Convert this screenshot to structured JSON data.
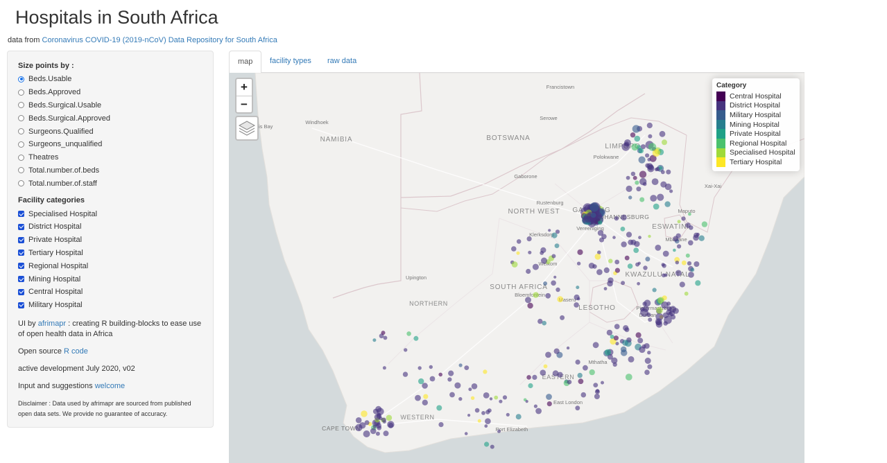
{
  "page": {
    "title": "Hospitals in South Africa",
    "source_prefix": "data from",
    "source_link": "Coronavirus COVID-19 (2019-nCoV) Data Repository for South Africa"
  },
  "sidebar": {
    "size_label": "Size points by :",
    "size_options": [
      "Beds.Usable",
      "Beds.Approved",
      "Beds.Surgical.Usable",
      "Beds.Surgical.Approved",
      "Surgeons.Qualified",
      "Surgeons_unqualified",
      "Theatres",
      "Total.number.of.beds",
      "Total.number.of.staff"
    ],
    "selected_size": "Beds.Usable",
    "categories_label": "Facility categories",
    "categories": [
      "Specialised Hospital",
      "District Hospital",
      "Private Hospital",
      "Tertiary Hospital",
      "Regional Hospital",
      "Mining Hospital",
      "Central Hospital",
      "Military Hospital"
    ],
    "ui_prefix": "UI by",
    "ui_link": "afrimapr",
    "ui_suffix": ": creating R building-blocks to ease use of open health data in Africa",
    "open_prefix": "Open source",
    "open_link": "R code",
    "dev_text": "active development July 2020, v02",
    "input_prefix": "Input and suggestions",
    "input_link": "welcome",
    "disclaimer": "Disclaimer : Data used by afrimapr are sourced from published open data sets. We provide no guarantee of accuracy."
  },
  "tabs": [
    "map",
    "facility types",
    "raw data"
  ],
  "active_tab": "map",
  "map": {
    "zoom_in": "+",
    "zoom_out": "−",
    "layers_icon": "layers-icon",
    "legend_title": "Category",
    "legend": [
      {
        "label": "Central Hospital",
        "color": "#440154"
      },
      {
        "label": "District Hospital",
        "color": "#46337e"
      },
      {
        "label": "Military Hospital",
        "color": "#365c8d"
      },
      {
        "label": "Mining Hospital",
        "color": "#277f8e"
      },
      {
        "label": "Private Hospital",
        "color": "#1fa187"
      },
      {
        "label": "Regional Hospital",
        "color": "#4ac16d"
      },
      {
        "label": "Specialised Hospital",
        "color": "#9fda3a"
      },
      {
        "label": "Tertiary Hospital",
        "color": "#fde725"
      }
    ],
    "country_labels": [
      "NAMIBIA",
      "BOTSWANA",
      "LIMPOPO",
      "NORTH WEST",
      "GAUTENG",
      "ESWATINI",
      "SOUTH AFRICA",
      "NORTHERN CAPE",
      "LESOTHO",
      "KWAZULU-NATAL",
      "EASTERN CAPE",
      "WESTERN CAPE"
    ],
    "place_labels": [
      "Francistown",
      "Serowe",
      "Windhoek",
      "Gaborone",
      "Polokwane",
      "Rustenburg",
      "JOHANNESBURG",
      "Vereeniging",
      "Klerksdorp",
      "Maputo",
      "Mbabane",
      "Xai-Xai",
      "Welkom",
      "Upington",
      "Bloemfontein",
      "Maseru",
      "Pietermaritzburg",
      "Durban",
      "Mthatha",
      "East London",
      "Port Elizabeth",
      "CAPE TOWN",
      "Walvis Bay"
    ]
  }
}
